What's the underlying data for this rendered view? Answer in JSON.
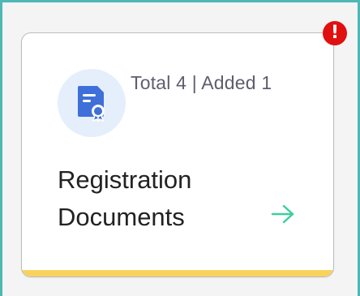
{
  "card": {
    "stats_text": "Total 4 | Added 1",
    "title": "Registration Documents",
    "icon": "certificate-document-icon",
    "action_icon": "arrow-right-icon",
    "alert_badge": "!"
  },
  "colors": {
    "frame_border": "#4db8b5",
    "card_accent": "#f9d25d",
    "icon_background": "#e5effb",
    "icon_color": "#3f6fd8",
    "arrow_color": "#3ccf9a",
    "alert_color": "#e01010"
  }
}
